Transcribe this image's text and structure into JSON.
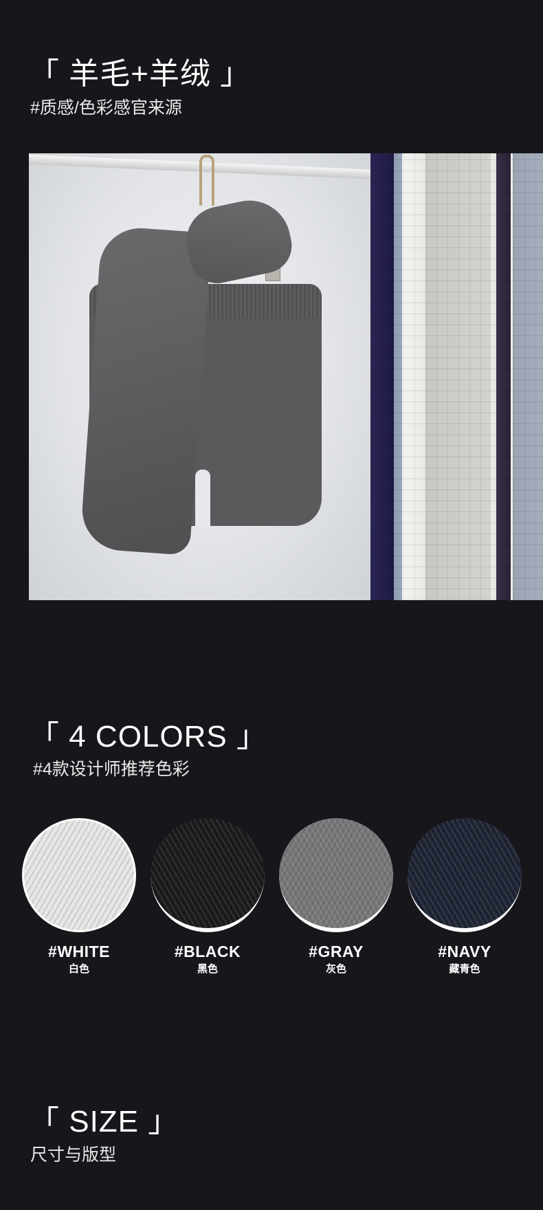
{
  "section1": {
    "title": "「 羊毛+羊绒 」",
    "subtitle": "#质感/色彩感官来源"
  },
  "section2": {
    "title": "「 4 COLORS 」",
    "subtitle": "#4款设计师推荐色彩"
  },
  "colors": [
    {
      "label_en": "#WHITE",
      "label_cn": "白色",
      "swatch": "#e7e6e4"
    },
    {
      "label_en": "#BLACK",
      "label_cn": "黑色",
      "swatch": "#1b1b1d"
    },
    {
      "label_en": "#GRAY",
      "label_cn": "灰色",
      "swatch": "#77787a"
    },
    {
      "label_en": "#NAVY",
      "label_cn": "藏青色",
      "swatch": "#1f2434"
    }
  ],
  "section3": {
    "title": "「 SIZE 」",
    "subtitle": "尺寸与版型"
  },
  "theme": {
    "background": "#17161b",
    "text": "#ffffff"
  }
}
